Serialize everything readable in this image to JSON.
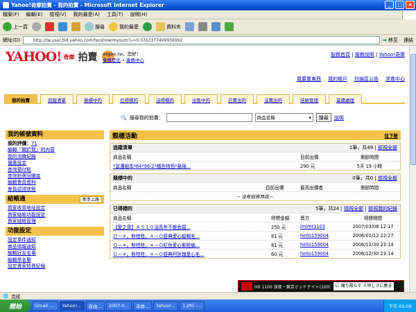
{
  "window": {
    "title": "Yahoo!奇摩拍賣 - 我的拍賣 - Microsoft Internet Explorer"
  },
  "menu": [
    "檔案(F)",
    "編輯(E)",
    "檢視(V)",
    "我的最愛(A)",
    "工具(T)",
    "說明(H)"
  ],
  "toolbar": {
    "back": "上一頁",
    "search": "搜尋",
    "favorites": "我的最愛",
    "history": "資料夾"
  },
  "address": {
    "label": "網址(D)",
    "url": "http://tw.user.bid.yahoo.com/tw/show/mysum?u=0.0763177499956992",
    "go": "移至",
    "links": "連結"
  },
  "page": {
    "logo": "YAHOO!",
    "logo_sub": "奇摩",
    "section_title": "拍賣",
    "user": {
      "id": "vsgoo.tw，您好！",
      "logout": "會員登出",
      "center": "會員中心"
    },
    "toplinks": [
      "服務首頁",
      "服務說明",
      "Yahoo!奇摩"
    ],
    "subnav": [
      "我要賣東西",
      "我的帳戶",
      "討論區公告",
      "求救中心"
    ],
    "tabs": [
      "我的拍賣",
      "追蹤清單",
      "競標中的",
      "已得標的",
      "沒得標的",
      "出售中的",
      "已賣出的",
      "沒賣出的",
      "結帳管理",
      "業績處理"
    ],
    "search": {
      "label": "搜尋我的拍賣：",
      "select": "商品名稱",
      "button": "搜尋",
      "help": "說明"
    },
    "left": {
      "account_title": "我的帳號資料",
      "rating_label": "我的評價：",
      "rating_value": "71",
      "links1": [
        "編輯『關於我』的內容",
        "我的消費紀錄",
        "優惠設定",
        "查詢預付點",
        "查詢拍賣回饋金",
        "編輯會員資料",
        "會員認證狀態"
      ],
      "jiebiao_title": "結帳通",
      "newbie": "新手上路",
      "links2": [
        "買家收貨地址設定",
        "賣家結帳功能設定",
        "賣家結帳管理"
      ],
      "func_title": "功能設定",
      "links3": [
        "設定事件通知",
        "商品情報通知",
        "編輯好友名單",
        "編輯黑名單",
        "設定賣家拍賣紀錄"
      ]
    },
    "right": {
      "title": "競標活動",
      "collapse": "往下移",
      "watch": {
        "title": "追蹤清單",
        "meta": "1筆，共49",
        "viewall": "檢視全部",
        "headers": [
          "商品名稱",
          "目前出價",
          "剩餘時間"
        ],
        "rows": [
          {
            "name": "*當濃縮本*64*96-2*橘色特色*藝綠...",
            "price": "290 元",
            "time": "5天 19 小時"
          }
        ]
      },
      "bidding": {
        "title": "競標中的",
        "meta": "0筆，共0",
        "viewall": "檢視全部",
        "headers": [
          "商品名稱",
          "目前出價",
          "最高出價者",
          "剩餘時間"
        ],
        "empty": "-- 沒有拍賣商品 --"
      },
      "won": {
        "title": "已得標的",
        "meta": "5筆，共24",
        "viewall": "檢視全部",
        "viewall2": "檢視我的紀錄",
        "headers": [
          "商品名稱",
          "得標金額",
          "賣方",
          "得標時間"
        ],
        "rows": [
          {
            "name": "【愛之寶】ＡＳ１０浴高年不散香園...",
            "price": "250 元",
            "seller": "lmlmt1103",
            "time": "2007/03/08 12:17"
          },
          {
            "name": "Ｏ－＊。粉桂桂。＊－Ｏ經典愛心編輯毛...",
            "price": "81 元",
            "seller": "hello159004",
            "time": "2006/01/12 22:27"
          },
          {
            "name": "Ｏ－＊。粉桂桂。＊－Ｏ紅色愛心紫姬編...",
            "price": "81 元",
            "seller": "hello159004",
            "time": "2006/12/30 23:14"
          },
          {
            "name": "Ｏ－＊。粉桂桂。＊－Ｏ經典阿狄瑰愛心毛...",
            "price": "60 元",
            "seller": "hello159004",
            "time": "2006/12/30 23:14"
          }
        ]
      }
    }
  },
  "status": {
    "text": "完成",
    "zone": "網際網路"
  },
  "taskbar": {
    "start": "開始",
    "tasks": [
      "Gmail -...",
      "Yahoo!...",
      "自由...",
      "2007-0...",
      "未命...",
      "Yahoo!...",
      "1.JPG -..."
    ],
    "clock": "下午 05:09"
  },
  "ticker": {
    "a": "Hit 1100 深夜・東京ミッドナイト(100)",
    "b": "に 織り殿らす 人世しさに集ま"
  }
}
